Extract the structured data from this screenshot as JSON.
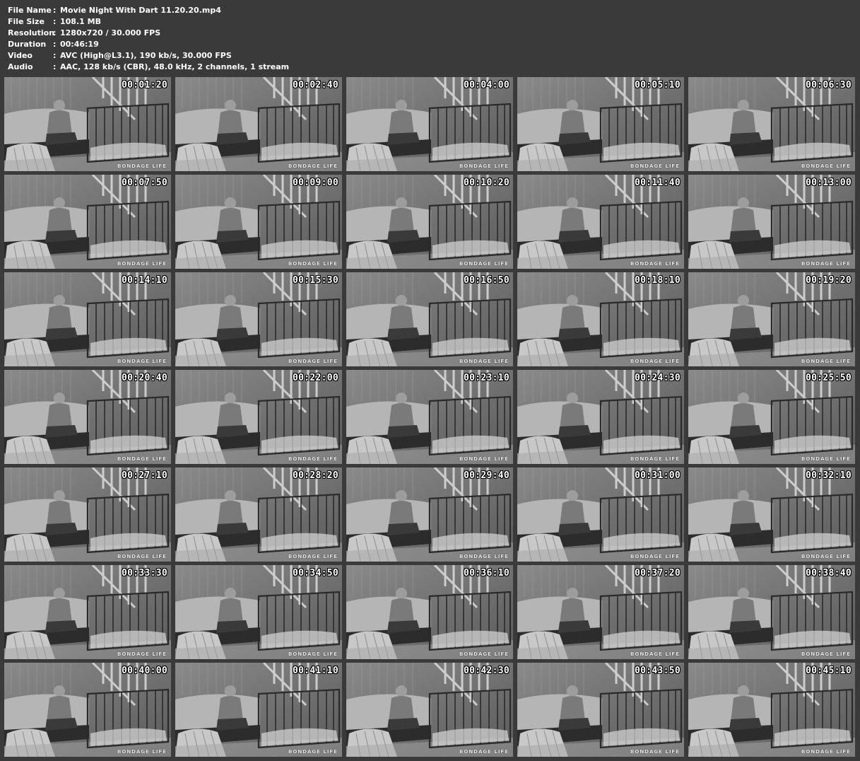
{
  "info": [
    {
      "label": "File Name",
      "value": "Movie Night With Dart 11.20.20.mp4"
    },
    {
      "label": "File Size",
      "value": "108.1 MB"
    },
    {
      "label": "Resolution",
      "value": "1280x720 / 30.000 FPS"
    },
    {
      "label": "Duration",
      "value": "00:46:19"
    },
    {
      "label": "Video",
      "value": "AVC (High@L3.1), 190 kb/s, 30.000 FPS"
    },
    {
      "label": "Audio",
      "value": "AAC, 128 kb/s (CBR), 48.0 kHz, 2 channels, 1 stream"
    }
  ],
  "separator": ":",
  "watermark": "BONDAGE LIFE",
  "timestamps": [
    "00:01:20",
    "00:02:40",
    "00:04:00",
    "00:05:10",
    "00:06:30",
    "00:07:50",
    "00:09:00",
    "00:10:20",
    "00:11:40",
    "00:13:00",
    "00:14:10",
    "00:15:30",
    "00:16:50",
    "00:18:10",
    "00:19:20",
    "00:20:40",
    "00:22:00",
    "00:23:10",
    "00:24:30",
    "00:25:50",
    "00:27:10",
    "00:28:20",
    "00:29:40",
    "00:31:00",
    "00:32:10",
    "00:33:30",
    "00:34:50",
    "00:36:10",
    "00:37:20",
    "00:38:40",
    "00:40:00",
    "00:41:10",
    "00:42:30",
    "00:43:50",
    "00:45:10"
  ]
}
